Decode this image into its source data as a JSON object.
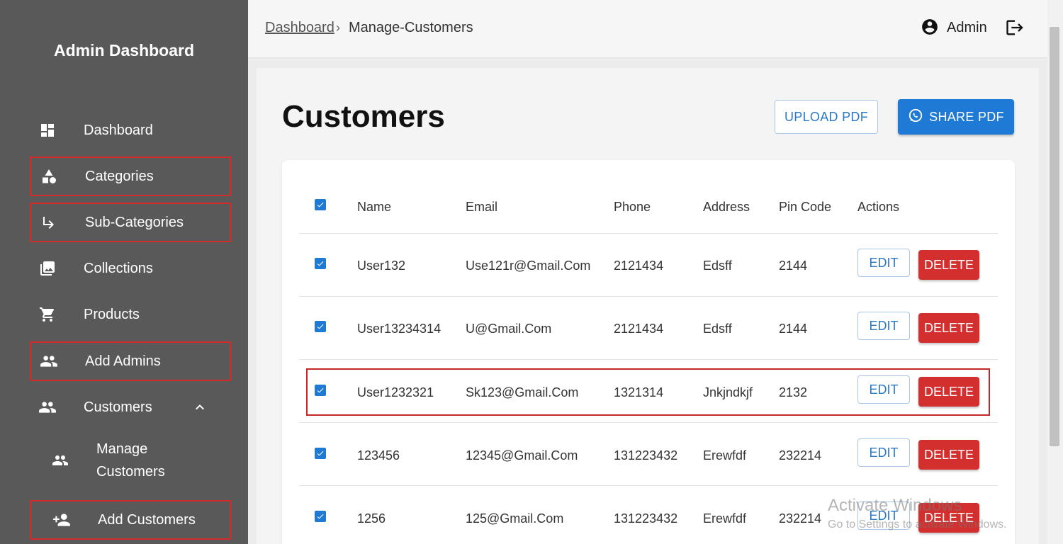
{
  "sidebar": {
    "brand": "Admin Dashboard",
    "items": [
      {
        "label": "Dashboard",
        "icon": "dashboard-icon"
      },
      {
        "label": "Categories",
        "icon": "category-icon"
      },
      {
        "label": "Sub-Categories",
        "icon": "subdirectory-arrow-icon"
      },
      {
        "label": "Collections",
        "icon": "collections-icon"
      },
      {
        "label": "Products",
        "icon": "cart-icon"
      },
      {
        "label": "Add Admins",
        "icon": "people-icon"
      },
      {
        "label": "Customers",
        "icon": "people-icon"
      },
      {
        "label": "Manage Customers",
        "icon": "people-outline-icon"
      },
      {
        "label": "Add Customers",
        "icon": "person-add-icon"
      }
    ]
  },
  "topbar": {
    "breadcrumb_link": "Dashboard",
    "breadcrumb_sep": "›",
    "breadcrumb_current": "Manage-Customers",
    "user_name": "Admin"
  },
  "main": {
    "title": "Customers",
    "upload_label": "UPLOAD PDF",
    "share_label": "SHARE PDF"
  },
  "table": {
    "headers": [
      "Name",
      "Email",
      "Phone",
      "Address",
      "Pin Code",
      "Actions"
    ],
    "edit_label": "EDIT",
    "delete_label": "DELETE",
    "rows": [
      {
        "name": "User132",
        "email": "Use121r@Gmail.Com",
        "phone": "2121434",
        "address": "Edsff",
        "pin": "2144"
      },
      {
        "name": "User13234314",
        "email": "U@Gmail.Com",
        "phone": "2121434",
        "address": "Edsff",
        "pin": "2144"
      },
      {
        "name": "User1232321",
        "email": "Sk123@Gmail.Com",
        "phone": "1321314",
        "address": "Jnkjndkjf",
        "pin": "2132"
      },
      {
        "name": "123456",
        "email": "12345@Gmail.Com",
        "phone": "131223432",
        "address": "Erewfdf",
        "pin": "232214"
      },
      {
        "name": "1256",
        "email": "125@Gmail.Com",
        "phone": "131223432",
        "address": "Erewfdf",
        "pin": "232214"
      }
    ]
  },
  "watermark": {
    "line1": "Activate Windows",
    "line2": "Go to Settings to activate Windows."
  },
  "colors": {
    "sidebar_bg": "#595959",
    "primary": "#1f7ad6",
    "danger": "#d32f2f",
    "highlight": "#d32a2a"
  }
}
